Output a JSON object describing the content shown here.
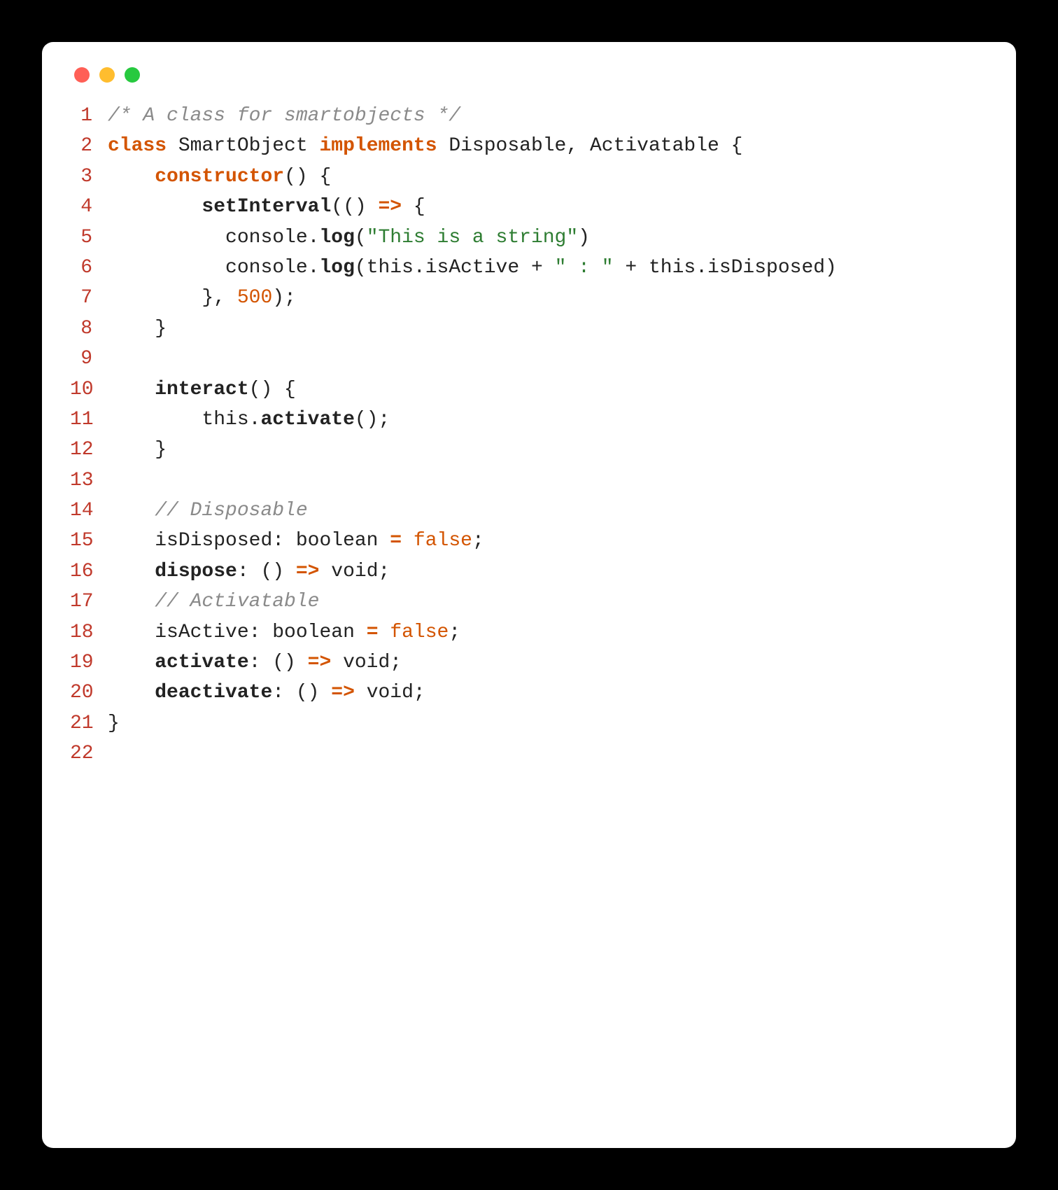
{
  "window": {
    "dots": [
      "red",
      "yellow",
      "green"
    ]
  },
  "code": {
    "lines": [
      {
        "n": "1",
        "tokens": [
          {
            "cls": "tok-comment",
            "text": "/* A class for smartobjects */"
          }
        ]
      },
      {
        "n": "2",
        "tokens": [
          {
            "cls": "tok-keyword",
            "text": "class"
          },
          {
            "cls": "tok-punct",
            "text": " "
          },
          {
            "cls": "tok-classname",
            "text": "SmartObject"
          },
          {
            "cls": "tok-punct",
            "text": " "
          },
          {
            "cls": "tok-keyword",
            "text": "implements"
          },
          {
            "cls": "tok-punct",
            "text": " "
          },
          {
            "cls": "tok-classname",
            "text": "Disposable"
          },
          {
            "cls": "tok-punct",
            "text": ", "
          },
          {
            "cls": "tok-classname",
            "text": "Activatable"
          },
          {
            "cls": "tok-punct",
            "text": " {"
          }
        ]
      },
      {
        "n": "3",
        "tokens": [
          {
            "cls": "tok-punct",
            "text": "    "
          },
          {
            "cls": "tok-keyword",
            "text": "constructor"
          },
          {
            "cls": "tok-punct",
            "text": "() {"
          }
        ]
      },
      {
        "n": "4",
        "tokens": [
          {
            "cls": "tok-punct",
            "text": "        "
          },
          {
            "cls": "tok-builtin",
            "text": "setInterval"
          },
          {
            "cls": "tok-punct",
            "text": "(() "
          },
          {
            "cls": "tok-arrow",
            "text": "=>"
          },
          {
            "cls": "tok-punct",
            "text": " {"
          }
        ]
      },
      {
        "n": "5",
        "tokens": [
          {
            "cls": "tok-punct",
            "text": "          "
          },
          {
            "cls": "tok-ident",
            "text": "console"
          },
          {
            "cls": "tok-punct",
            "text": "."
          },
          {
            "cls": "tok-builtin",
            "text": "log"
          },
          {
            "cls": "tok-punct",
            "text": "("
          },
          {
            "cls": "tok-string",
            "text": "\"This is a string\""
          },
          {
            "cls": "tok-punct",
            "text": ")"
          }
        ]
      },
      {
        "n": "6",
        "tokens": [
          {
            "cls": "tok-punct",
            "text": "          "
          },
          {
            "cls": "tok-ident",
            "text": "console"
          },
          {
            "cls": "tok-punct",
            "text": "."
          },
          {
            "cls": "tok-builtin",
            "text": "log"
          },
          {
            "cls": "tok-punct",
            "text": "("
          },
          {
            "cls": "tok-this",
            "text": "this"
          },
          {
            "cls": "tok-punct",
            "text": ".isActive + "
          },
          {
            "cls": "tok-string",
            "text": "\" : \""
          },
          {
            "cls": "tok-punct",
            "text": " + "
          },
          {
            "cls": "tok-this",
            "text": "this"
          },
          {
            "cls": "tok-punct",
            "text": ".isDisposed)"
          }
        ]
      },
      {
        "n": "7",
        "tokens": [
          {
            "cls": "tok-punct",
            "text": "        }, "
          },
          {
            "cls": "tok-number",
            "text": "500"
          },
          {
            "cls": "tok-punct",
            "text": ");"
          }
        ]
      },
      {
        "n": "8",
        "tokens": [
          {
            "cls": "tok-punct",
            "text": "    }"
          }
        ]
      },
      {
        "n": "9",
        "tokens": [
          {
            "cls": "tok-punct",
            "text": ""
          }
        ]
      },
      {
        "n": "10",
        "tokens": [
          {
            "cls": "tok-punct",
            "text": "    "
          },
          {
            "cls": "tok-fn",
            "text": "interact"
          },
          {
            "cls": "tok-punct",
            "text": "() {"
          }
        ]
      },
      {
        "n": "11",
        "tokens": [
          {
            "cls": "tok-punct",
            "text": "        "
          },
          {
            "cls": "tok-this",
            "text": "this"
          },
          {
            "cls": "tok-punct",
            "text": "."
          },
          {
            "cls": "tok-fn",
            "text": "activate"
          },
          {
            "cls": "tok-punct",
            "text": "();"
          }
        ]
      },
      {
        "n": "12",
        "tokens": [
          {
            "cls": "tok-punct",
            "text": "    }"
          }
        ]
      },
      {
        "n": "13",
        "tokens": [
          {
            "cls": "tok-punct",
            "text": ""
          }
        ]
      },
      {
        "n": "14",
        "tokens": [
          {
            "cls": "tok-punct",
            "text": "    "
          },
          {
            "cls": "tok-comment",
            "text": "// Disposable"
          }
        ]
      },
      {
        "n": "15",
        "tokens": [
          {
            "cls": "tok-punct",
            "text": "    "
          },
          {
            "cls": "tok-ident",
            "text": "isDisposed"
          },
          {
            "cls": "tok-punct",
            "text": ": "
          },
          {
            "cls": "tok-ident",
            "text": "boolean"
          },
          {
            "cls": "tok-punct",
            "text": " "
          },
          {
            "cls": "tok-op",
            "text": "="
          },
          {
            "cls": "tok-punct",
            "text": " "
          },
          {
            "cls": "tok-bool",
            "text": "false"
          },
          {
            "cls": "tok-punct",
            "text": ";"
          }
        ]
      },
      {
        "n": "16",
        "tokens": [
          {
            "cls": "tok-punct",
            "text": "    "
          },
          {
            "cls": "tok-prop",
            "text": "dispose"
          },
          {
            "cls": "tok-punct",
            "text": ": () "
          },
          {
            "cls": "tok-arrow",
            "text": "=>"
          },
          {
            "cls": "tok-punct",
            "text": " "
          },
          {
            "cls": "tok-ident",
            "text": "void"
          },
          {
            "cls": "tok-punct",
            "text": ";"
          }
        ]
      },
      {
        "n": "17",
        "tokens": [
          {
            "cls": "tok-punct",
            "text": "    "
          },
          {
            "cls": "tok-comment",
            "text": "// Activatable"
          }
        ]
      },
      {
        "n": "18",
        "tokens": [
          {
            "cls": "tok-punct",
            "text": "    "
          },
          {
            "cls": "tok-ident",
            "text": "isActive"
          },
          {
            "cls": "tok-punct",
            "text": ": "
          },
          {
            "cls": "tok-ident",
            "text": "boolean"
          },
          {
            "cls": "tok-punct",
            "text": " "
          },
          {
            "cls": "tok-op",
            "text": "="
          },
          {
            "cls": "tok-punct",
            "text": " "
          },
          {
            "cls": "tok-bool",
            "text": "false"
          },
          {
            "cls": "tok-punct",
            "text": ";"
          }
        ]
      },
      {
        "n": "19",
        "tokens": [
          {
            "cls": "tok-punct",
            "text": "    "
          },
          {
            "cls": "tok-prop",
            "text": "activate"
          },
          {
            "cls": "tok-punct",
            "text": ": () "
          },
          {
            "cls": "tok-arrow",
            "text": "=>"
          },
          {
            "cls": "tok-punct",
            "text": " "
          },
          {
            "cls": "tok-ident",
            "text": "void"
          },
          {
            "cls": "tok-punct",
            "text": ";"
          }
        ]
      },
      {
        "n": "20",
        "tokens": [
          {
            "cls": "tok-punct",
            "text": "    "
          },
          {
            "cls": "tok-prop",
            "text": "deactivate"
          },
          {
            "cls": "tok-punct",
            "text": ": () "
          },
          {
            "cls": "tok-arrow",
            "text": "=>"
          },
          {
            "cls": "tok-punct",
            "text": " "
          },
          {
            "cls": "tok-ident",
            "text": "void"
          },
          {
            "cls": "tok-punct",
            "text": ";"
          }
        ]
      },
      {
        "n": "21",
        "tokens": [
          {
            "cls": "tok-punct",
            "text": "}"
          }
        ]
      },
      {
        "n": "22",
        "tokens": [
          {
            "cls": "tok-punct",
            "text": ""
          }
        ]
      }
    ]
  }
}
